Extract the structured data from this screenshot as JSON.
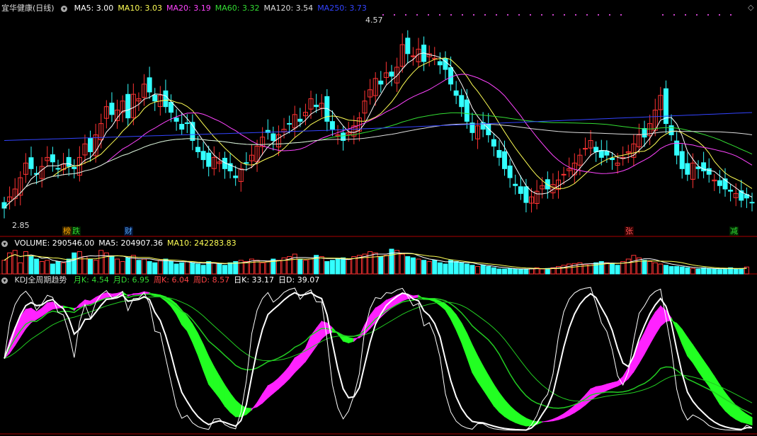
{
  "header": {
    "stock_name": "宜华健康(日线)",
    "ma_items": [
      {
        "label": "MA5: 3.00",
        "color": "#ffffff"
      },
      {
        "label": "MA10: 3.03",
        "color": "#ffff55"
      },
      {
        "label": "MA20: 3.19",
        "color": "#ff44ff"
      },
      {
        "label": "MA60: 3.32",
        "color": "#33dd33"
      },
      {
        "label": "MA120: 3.54",
        "color": "#dddddd"
      },
      {
        "label": "MA250: 3.73",
        "color": "#3344ff"
      }
    ],
    "high_label": "4.57",
    "low_label": "2.85",
    "event_tags": [
      {
        "text": "榜",
        "color": "#ffaa00"
      },
      {
        "text": "跌",
        "color": "#33dd33"
      },
      {
        "text": "财",
        "color": "#55aaff"
      },
      {
        "text": "张",
        "color": "#ff5555"
      },
      {
        "text": "减",
        "color": "#33dd33"
      }
    ]
  },
  "volume_header": {
    "items": [
      {
        "label": "VOLUME: 290546.00",
        "color": "#ffffff"
      },
      {
        "label": "MA5: 204907.36",
        "color": "#ffffff"
      },
      {
        "label": "MA10: 242283.83",
        "color": "#ffff55"
      }
    ]
  },
  "kdj_header": {
    "title": "KDJ全周期趋势",
    "items": [
      {
        "label": "月K: 4.54",
        "color": "#33dd33"
      },
      {
        "label": "月D: 6.95",
        "color": "#33dd33"
      },
      {
        "label": "周K: 6.04",
        "color": "#ff4444"
      },
      {
        "label": "周D: 8.57",
        "color": "#ff4444"
      },
      {
        "label": "日K: 33.17",
        "color": "#ffffff"
      },
      {
        "label": "日D: 39.07",
        "color": "#ffffff"
      }
    ]
  },
  "colors": {
    "up": "#ff3333",
    "down": "#33ffff",
    "magenta": "#ff22ff",
    "green": "#22ff22",
    "panel_border": "#aa0000"
  },
  "chart_data": {
    "type": "candlestick",
    "price_range": [
      2.85,
      4.57
    ],
    "closes": [
      2.95,
      3.05,
      3.12,
      3.22,
      3.35,
      3.3,
      3.25,
      3.32,
      3.4,
      3.36,
      3.3,
      3.34,
      3.32,
      3.3,
      3.4,
      3.52,
      3.45,
      3.6,
      3.7,
      3.85,
      3.78,
      3.82,
      3.9,
      3.75,
      3.96,
      3.92,
      4.05,
      3.98,
      3.9,
      3.95,
      3.85,
      3.8,
      3.72,
      3.65,
      3.7,
      3.55,
      3.45,
      3.38,
      3.32,
      3.4,
      3.36,
      3.3,
      3.28,
      3.22,
      3.3,
      3.35,
      3.42,
      3.5,
      3.58,
      3.62,
      3.55,
      3.6,
      3.65,
      3.7,
      3.78,
      3.72,
      3.8,
      3.92,
      3.85,
      3.88,
      3.72,
      3.65,
      3.6,
      3.55,
      3.62,
      3.68,
      3.75,
      3.9,
      4.0,
      4.1,
      4.05,
      4.15,
      4.12,
      4.2,
      4.4,
      4.32,
      4.3,
      4.36,
      4.25,
      4.32,
      4.28,
      4.22,
      4.18,
      4.05,
      3.95,
      3.85,
      3.72,
      3.62,
      3.68,
      3.65,
      3.6,
      3.5,
      3.4,
      3.3,
      3.22,
      3.15,
      3.08,
      3.0,
      3.05,
      3.1,
      3.15,
      3.12,
      3.16,
      3.2,
      3.25,
      3.3,
      3.35,
      3.42,
      3.48,
      3.55,
      3.45,
      3.4,
      3.42,
      3.38,
      3.35,
      3.4,
      3.45,
      3.52,
      3.6,
      3.58,
      3.7,
      3.82,
      3.95,
      3.7,
      3.6,
      3.42,
      3.3,
      3.25,
      3.35,
      3.3,
      3.28,
      3.25,
      3.2,
      3.15,
      3.12,
      3.1,
      3.08,
      3.02,
      3.04,
      3.0
    ],
    "volumes": [
      0.55,
      0.85,
      0.95,
      0.45,
      0.9,
      0.7,
      0.6,
      0.5,
      0.55,
      0.4,
      0.5,
      0.45,
      0.6,
      0.85,
      0.9,
      0.7,
      0.6,
      0.55,
      0.95,
      0.85,
      0.7,
      0.6,
      0.5,
      0.65,
      0.75,
      0.55,
      0.6,
      0.5,
      0.45,
      0.55,
      0.6,
      0.5,
      0.4,
      0.45,
      0.5,
      0.45,
      0.4,
      0.35,
      0.5,
      0.45,
      0.4,
      0.35,
      0.45,
      0.5,
      0.55,
      0.5,
      0.6,
      0.55,
      0.45,
      0.5,
      0.6,
      0.55,
      0.65,
      0.7,
      0.8,
      0.6,
      0.55,
      0.6,
      0.75,
      0.7,
      0.5,
      0.55,
      0.6,
      0.65,
      0.6,
      0.7,
      0.75,
      0.8,
      0.9,
      0.85,
      0.7,
      0.75,
      1.0,
      0.95,
      0.8,
      0.7,
      0.65,
      0.6,
      0.55,
      0.5,
      0.55,
      0.45,
      0.4,
      0.55,
      0.5,
      0.45,
      0.4,
      0.35,
      0.3,
      0.35,
      0.3,
      0.25,
      0.2,
      0.2,
      0.22,
      0.2,
      0.18,
      0.2,
      0.22,
      0.25,
      0.2,
      0.22,
      0.25,
      0.3,
      0.35,
      0.4,
      0.42,
      0.45,
      0.38,
      0.4,
      0.45,
      0.5,
      0.45,
      0.4,
      0.35,
      0.5,
      0.6,
      0.75,
      0.65,
      0.55,
      0.5,
      0.45,
      0.4,
      0.35,
      0.3,
      0.3,
      0.28,
      0.25,
      0.22,
      0.2,
      0.25,
      0.22,
      0.2,
      0.18,
      0.22,
      0.25,
      0.2,
      0.22,
      0.28
    ],
    "kdj_series": [
      "月K",
      "月D",
      "周K",
      "周D",
      "日K",
      "日D"
    ]
  }
}
